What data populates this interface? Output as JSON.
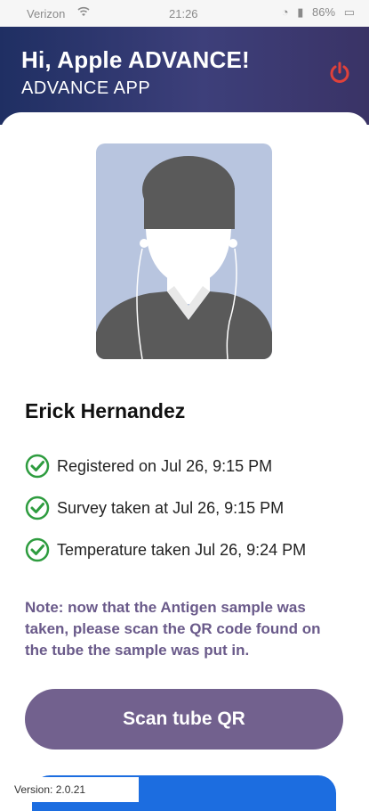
{
  "status_bar": {
    "carrier": "Verizon",
    "time": "21:26",
    "battery": "86%"
  },
  "header": {
    "greeting": "Hi, Apple ADVANCE!",
    "app_name": "ADVANCE APP",
    "power_icon": "power-icon",
    "power_color": "#e0413a"
  },
  "profile": {
    "name": "Erick Hernandez",
    "photo_icon": "person-silhouette-icon"
  },
  "statuses": [
    {
      "label": "Registered on Jul 26, 9:15 PM",
      "icon": "check-circle-icon"
    },
    {
      "label": "Survey taken at Jul 26, 9:15 PM",
      "icon": "check-circle-icon"
    },
    {
      "label": "Temperature taken Jul 26, 9:24 PM",
      "icon": "check-circle-icon"
    }
  ],
  "note": "Note: now that the Antigen sample was taken, please scan the QR code found on the tube the sample was put in.",
  "scan_button": {
    "label": "Scan tube QR"
  },
  "footer": {
    "version": "Version: 2.0.21"
  },
  "colors": {
    "header_start": "#1f2f63",
    "header_end": "#3a3366",
    "check_green": "#2e9c3f",
    "note_purple": "#6a5a8a",
    "button_purple": "#72618e",
    "secondary_button_blue": "#1c6de0"
  }
}
